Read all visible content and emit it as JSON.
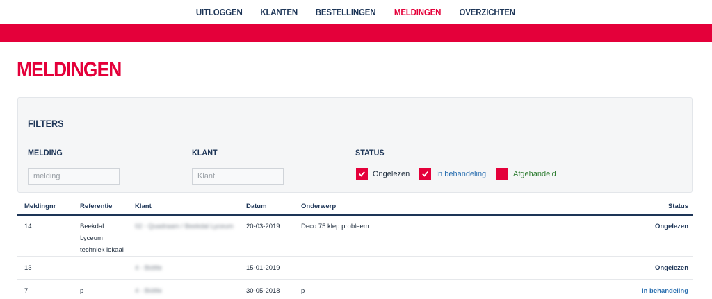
{
  "nav": {
    "items": [
      "UITLOGGEN",
      "KLANTEN",
      "BESTELLINGEN",
      "MELDINGEN",
      "OVERZICHTEN"
    ],
    "active": "MELDINGEN"
  },
  "page": {
    "title": "MELDINGEN"
  },
  "filters": {
    "title": "FILTERS",
    "melding_label": "MELDING",
    "melding_placeholder": "melding",
    "klant_label": "KLANT",
    "klant_placeholder": "Klant",
    "status_label": "STATUS",
    "status_options": [
      {
        "label": "Ongelezen",
        "checked": true,
        "color": "#1f2d3d"
      },
      {
        "label": "In behandeling",
        "checked": true,
        "color": "#2a6fb0"
      },
      {
        "label": "Afgehandeld",
        "checked": false,
        "color": "#2e7d32"
      }
    ]
  },
  "table": {
    "columns": [
      "Meldingnr",
      "Referentie",
      "Klant",
      "Datum",
      "Onderwerp",
      "Status"
    ],
    "rows": [
      {
        "nr": "14",
        "referentie": "Beekdal Lyceum techniek lokaal",
        "klant": "02 - Quadraam / Beekdal Lyceum",
        "datum": "20-03-2019",
        "onderwerp": "Deco 75 klep probleem",
        "status": "Ongelezen"
      },
      {
        "nr": "13",
        "referentie": "",
        "klant": "4 - Bidille",
        "datum": "15-01-2019",
        "onderwerp": "",
        "status": "Ongelezen"
      },
      {
        "nr": "7",
        "referentie": "p",
        "klant": "4 - Bidille",
        "datum": "30-05-2018",
        "onderwerp": "p",
        "status": "In behandeling"
      }
    ]
  },
  "colors": {
    "accent": "#e4003a",
    "navy": "#1d3557",
    "in_behandeling": "#2a6fb0",
    "afgehandeld": "#2e7d32"
  }
}
